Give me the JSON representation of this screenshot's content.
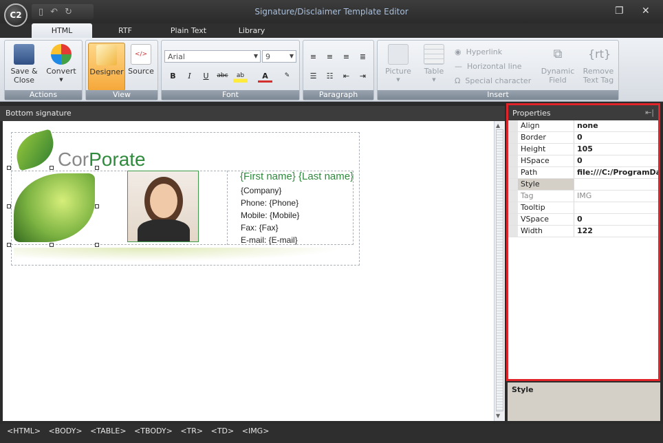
{
  "window": {
    "title": "Signature/Disclaimer Template Editor",
    "app_logo": "C2"
  },
  "ribbon_tabs": [
    "HTML",
    "RTF",
    "Plain Text",
    "Library"
  ],
  "groups": {
    "actions": {
      "label": "Actions",
      "save": "Save &\nClose",
      "convert": "Convert"
    },
    "view": {
      "label": "View",
      "designer": "Designer",
      "source": "Source"
    },
    "font": {
      "label": "Font",
      "family": "Arial",
      "size": "9"
    },
    "paragraph": {
      "label": "Paragraph"
    },
    "insert": {
      "label": "Insert",
      "picture": "Picture",
      "table": "Table",
      "hyperlink": "Hyperlink",
      "hline": "Horizontal line",
      "special": "Special character",
      "dynamic": "Dynamic\nField",
      "remove": "Remove\nText Tag"
    }
  },
  "document": {
    "header": "Bottom signature",
    "brand_a": "Cor",
    "brand_b": "Porate",
    "name_line": "{First name} {Last name}",
    "company": "{Company}",
    "phone": "Phone: {Phone}",
    "mobile": "Mobile: {Mobile}",
    "fax": "Fax: {Fax}",
    "email": "E-mail: {E-mail}"
  },
  "properties": {
    "title": "Properties",
    "rows": [
      {
        "k": "Align",
        "v": "none"
      },
      {
        "k": "Border",
        "v": "0"
      },
      {
        "k": "Height",
        "v": "105"
      },
      {
        "k": "HSpace",
        "v": "0"
      },
      {
        "k": "Path",
        "v": "file:///C:/ProgramDa"
      },
      {
        "k": "Style",
        "v": ""
      },
      {
        "k": "Tag",
        "v": "IMG"
      },
      {
        "k": "Tooltip",
        "v": ""
      },
      {
        "k": "VSpace",
        "v": "0"
      },
      {
        "k": "Width",
        "v": "122"
      }
    ],
    "description": "Style"
  },
  "statusbar": [
    "<HTML>",
    "<BODY>",
    "<TABLE>",
    "<TBODY>",
    "<TR>",
    "<TD>",
    "<IMG>"
  ],
  "colors": {
    "brand_green": "#2e8b3c",
    "highlight_red": "#e0242a"
  }
}
